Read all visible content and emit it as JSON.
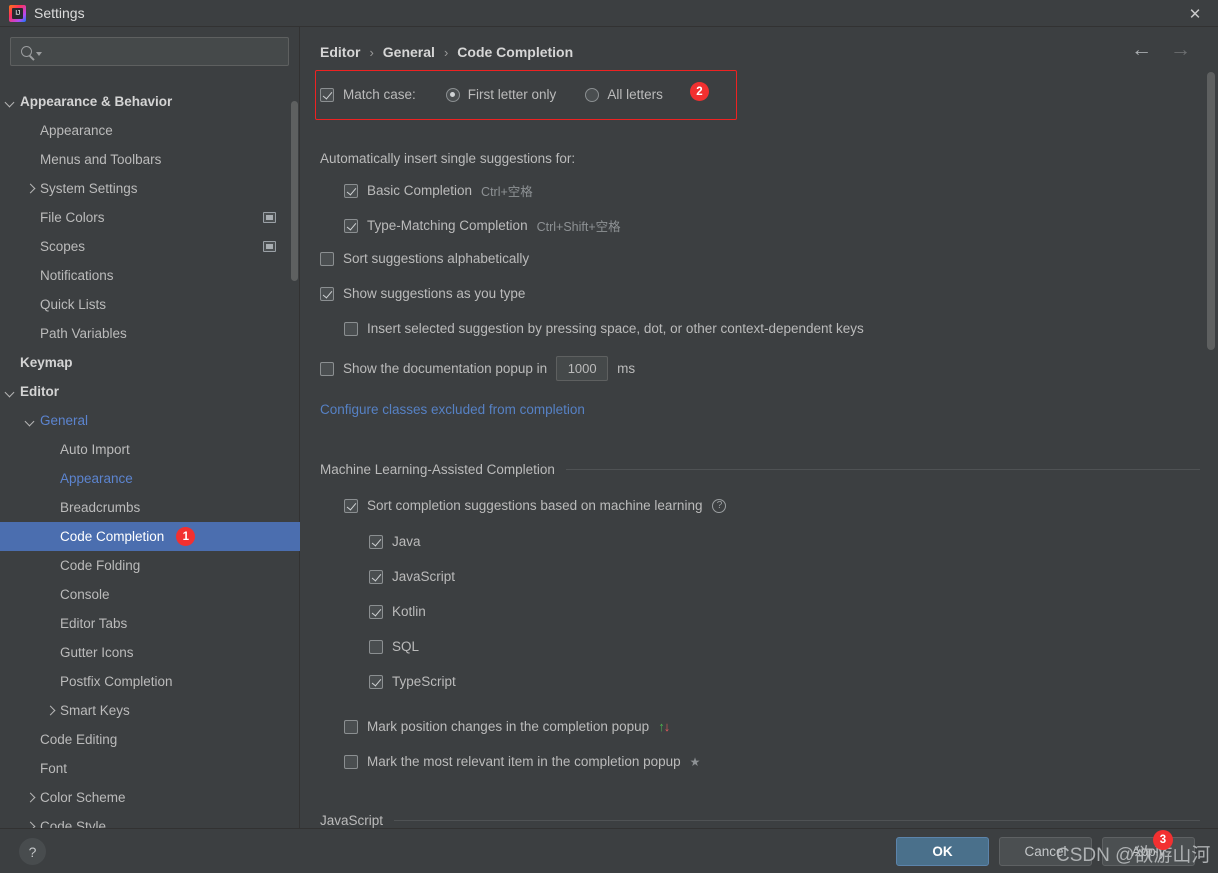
{
  "window": {
    "title": "Settings",
    "logo_text": "IJ",
    "close_label": "✕"
  },
  "sidebar": {
    "search": {
      "value": "",
      "placeholder": ""
    },
    "items": [
      {
        "label": "Appearance & Behavior",
        "indent": 1,
        "arrow": "down",
        "bold": true,
        "blue": false,
        "selected": false,
        "side_icon": false,
        "badge": ""
      },
      {
        "label": "Appearance",
        "indent": 2,
        "arrow": "none",
        "bold": false,
        "blue": false,
        "selected": false,
        "side_icon": false,
        "badge": ""
      },
      {
        "label": "Menus and Toolbars",
        "indent": 2,
        "arrow": "none",
        "bold": false,
        "blue": false,
        "selected": false,
        "side_icon": false,
        "badge": ""
      },
      {
        "label": "System Settings",
        "indent": 2,
        "arrow": "right",
        "bold": false,
        "blue": false,
        "selected": false,
        "side_icon": false,
        "badge": ""
      },
      {
        "label": "File Colors",
        "indent": 2,
        "arrow": "none",
        "bold": false,
        "blue": false,
        "selected": false,
        "side_icon": true,
        "badge": ""
      },
      {
        "label": "Scopes",
        "indent": 2,
        "arrow": "none",
        "bold": false,
        "blue": false,
        "selected": false,
        "side_icon": true,
        "badge": ""
      },
      {
        "label": "Notifications",
        "indent": 2,
        "arrow": "none",
        "bold": false,
        "blue": false,
        "selected": false,
        "side_icon": false,
        "badge": ""
      },
      {
        "label": "Quick Lists",
        "indent": 2,
        "arrow": "none",
        "bold": false,
        "blue": false,
        "selected": false,
        "side_icon": false,
        "badge": ""
      },
      {
        "label": "Path Variables",
        "indent": 2,
        "arrow": "none",
        "bold": false,
        "blue": false,
        "selected": false,
        "side_icon": false,
        "badge": ""
      },
      {
        "label": "Keymap",
        "indent": 1,
        "arrow": "none",
        "bold": true,
        "blue": false,
        "selected": false,
        "side_icon": false,
        "badge": ""
      },
      {
        "label": "Editor",
        "indent": 1,
        "arrow": "down",
        "bold": true,
        "blue": false,
        "selected": false,
        "side_icon": false,
        "badge": ""
      },
      {
        "label": "General",
        "indent": 2,
        "arrow": "down",
        "bold": false,
        "blue": true,
        "selected": false,
        "side_icon": false,
        "badge": ""
      },
      {
        "label": "Auto Import",
        "indent": 3,
        "arrow": "none",
        "bold": false,
        "blue": false,
        "selected": false,
        "side_icon": false,
        "badge": ""
      },
      {
        "label": "Appearance",
        "indent": 3,
        "arrow": "none",
        "bold": false,
        "blue": true,
        "selected": false,
        "side_icon": false,
        "badge": ""
      },
      {
        "label": "Breadcrumbs",
        "indent": 3,
        "arrow": "none",
        "bold": false,
        "blue": false,
        "selected": false,
        "side_icon": false,
        "badge": ""
      },
      {
        "label": "Code Completion",
        "indent": 3,
        "arrow": "none",
        "bold": false,
        "blue": false,
        "selected": true,
        "side_icon": false,
        "badge": "1"
      },
      {
        "label": "Code Folding",
        "indent": 3,
        "arrow": "none",
        "bold": false,
        "blue": false,
        "selected": false,
        "side_icon": false,
        "badge": ""
      },
      {
        "label": "Console",
        "indent": 3,
        "arrow": "none",
        "bold": false,
        "blue": false,
        "selected": false,
        "side_icon": false,
        "badge": ""
      },
      {
        "label": "Editor Tabs",
        "indent": 3,
        "arrow": "none",
        "bold": false,
        "blue": false,
        "selected": false,
        "side_icon": false,
        "badge": ""
      },
      {
        "label": "Gutter Icons",
        "indent": 3,
        "arrow": "none",
        "bold": false,
        "blue": false,
        "selected": false,
        "side_icon": false,
        "badge": ""
      },
      {
        "label": "Postfix Completion",
        "indent": 3,
        "arrow": "none",
        "bold": false,
        "blue": false,
        "selected": false,
        "side_icon": false,
        "badge": ""
      },
      {
        "label": "Smart Keys",
        "indent": 3,
        "arrow": "right",
        "bold": false,
        "blue": false,
        "selected": false,
        "side_icon": false,
        "badge": ""
      },
      {
        "label": "Code Editing",
        "indent": 2,
        "arrow": "none",
        "bold": false,
        "blue": false,
        "selected": false,
        "side_icon": false,
        "badge": ""
      },
      {
        "label": "Font",
        "indent": 2,
        "arrow": "none",
        "bold": false,
        "blue": false,
        "selected": false,
        "side_icon": false,
        "badge": ""
      },
      {
        "label": "Color Scheme",
        "indent": 2,
        "arrow": "right",
        "bold": false,
        "blue": false,
        "selected": false,
        "side_icon": false,
        "badge": ""
      },
      {
        "label": "Code Style",
        "indent": 2,
        "arrow": "right",
        "bold": false,
        "blue": false,
        "selected": false,
        "side_icon": false,
        "badge": ""
      }
    ]
  },
  "content": {
    "breadcrumb": {
      "p1": "Editor",
      "p2": "General",
      "p3": "Code Completion",
      "sep": "›"
    },
    "nav": {
      "back": "←",
      "forward": "→"
    },
    "match_case": {
      "checkbox_label": "Match case:",
      "checked": true,
      "option_first": "First letter only",
      "option_all": "All letters",
      "selected_option": "First letter only",
      "badge": "2"
    },
    "auto_insert_title": "Automatically insert single suggestions for:",
    "auto_insert_items": [
      {
        "label": "Basic Completion",
        "shortcut": "Ctrl+空格",
        "checked": true
      },
      {
        "label": "Type-Matching Completion",
        "shortcut": "Ctrl+Shift+空格",
        "checked": true
      }
    ],
    "sort_alpha": {
      "label": "Sort suggestions alphabetically",
      "checked": false
    },
    "show_as_type": {
      "label": "Show suggestions as you type",
      "checked": true
    },
    "insert_selected": {
      "label": "Insert selected suggestion by pressing space, dot, or other context-dependent keys",
      "checked": false
    },
    "doc_popup": {
      "label": "Show the documentation popup in",
      "checked": false,
      "value": "1000",
      "unit": "ms"
    },
    "excluded_link": "Configure classes excluded from completion",
    "ml_section": {
      "title": "Machine Learning-Assisted Completion",
      "sort_ml": {
        "label": "Sort completion suggestions based on machine learning",
        "checked": true,
        "help_icon": "?"
      },
      "languages": [
        {
          "label": "Java",
          "checked": true
        },
        {
          "label": "JavaScript",
          "checked": true
        },
        {
          "label": "Kotlin",
          "checked": true
        },
        {
          "label": "SQL",
          "checked": false
        },
        {
          "label": "TypeScript",
          "checked": true
        }
      ],
      "mark_position": {
        "label": "Mark position changes in the completion popup",
        "checked": false,
        "icon_up": "↑",
        "icon_down": "↓"
      },
      "mark_relevant": {
        "label": "Mark the most relevant item in the completion popup",
        "checked": false,
        "icon": "★"
      }
    },
    "javascript_section": {
      "title": "JavaScript"
    }
  },
  "bottom": {
    "help": "?",
    "ok": "OK",
    "cancel": "Cancel",
    "apply": "Apply",
    "apply_badge": "3",
    "watermark": "CSDN @欲游山河"
  }
}
